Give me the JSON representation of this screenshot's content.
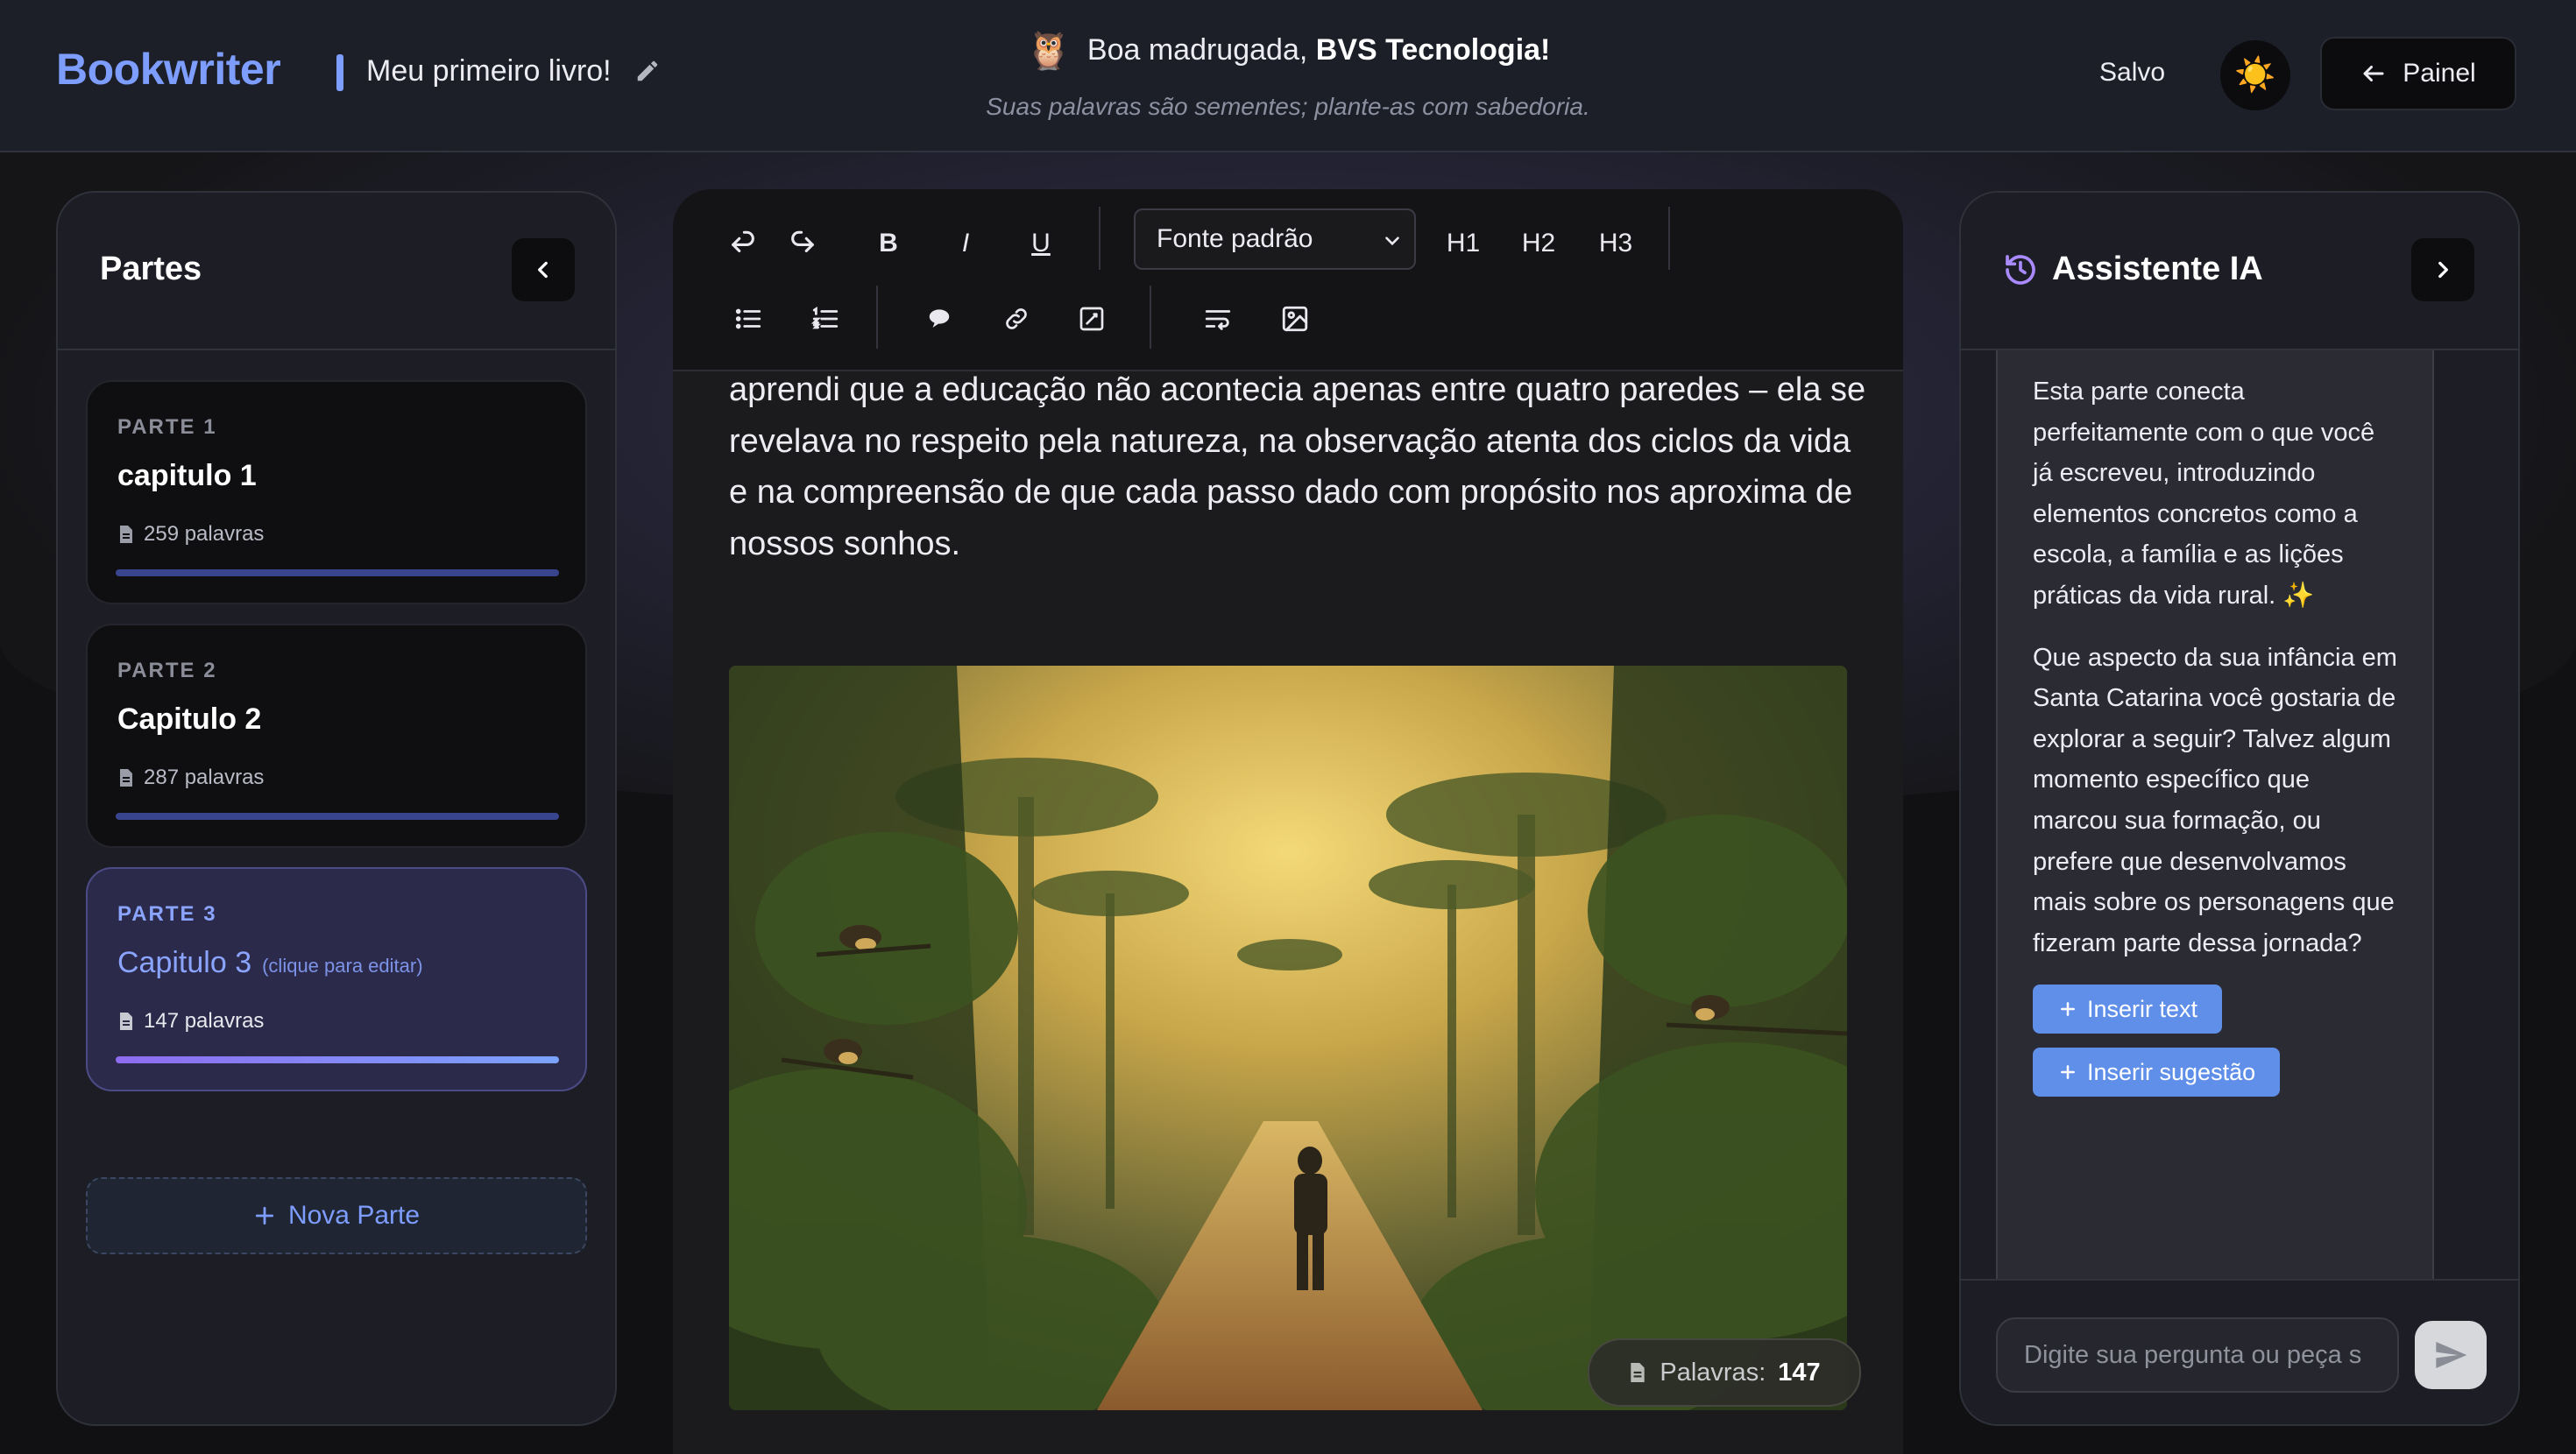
{
  "app": {
    "name": "Bookwriter",
    "book_title": "Meu primeiro livro!"
  },
  "header": {
    "greeting_prefix": "Boa madrugada,",
    "greeting_name": "BVS Tecnologia!",
    "greeting_icon": "🦉",
    "motto": "Suas palavras são sementes; plante-as com sabedoria.",
    "save_status": "Salvo",
    "theme_icon": "☀️",
    "panel_label": "Painel"
  },
  "sidebar": {
    "title": "Partes",
    "parts": [
      {
        "label": "PARTE 1",
        "name": "capitulo 1",
        "hint": "",
        "words": "259 palavras"
      },
      {
        "label": "PARTE 2",
        "name": "Capitulo 2",
        "hint": "",
        "words": "287 palavras"
      },
      {
        "label": "PARTE 3",
        "name": "Capitulo 3",
        "hint": "(clique para editar)",
        "words": "147 palavras",
        "active": true
      }
    ],
    "new_part_label": "Nova Parte"
  },
  "toolbar": {
    "bold": "B",
    "italic": "I",
    "underline": "U",
    "font_select_value": "Fonte padrão",
    "h1": "H1",
    "h2": "H2",
    "h3": "H3"
  },
  "editor": {
    "text": "aprendi que a educação não acontecia apenas entre quatro paredes – ela se revelava no respeito pela natureza, na observação atenta dos ciclos da vida e na compreensão de que cada passo dado com propósito nos aproxima de nossos sonhos.",
    "word_count_label": "Palavras:",
    "word_count_value": "147"
  },
  "assistant": {
    "title": "Assistente IA",
    "message_p1": "Esta parte conecta perfeitamente com o que você já escreveu, introduzindo elementos concretos como a escola, a família e as lições práticas da vida rural. ✨",
    "message_p2": "Que aspecto da sua infância em Santa Catarina você gostaria de explorar a seguir? Talvez algum momento específico que marcou sua formação, ou prefere que desenvolvamos mais sobre os personagens que fizeram parte dessa jornada?",
    "insert_text_label": "Inserir text",
    "insert_suggestion_label": "Inserir sugestão",
    "input_placeholder": "Digite sua pergunta ou peça s"
  },
  "colors": {
    "accent": "#7d9dff",
    "active_card": "#2b2a4a",
    "insert_button": "#5f8fe8"
  }
}
